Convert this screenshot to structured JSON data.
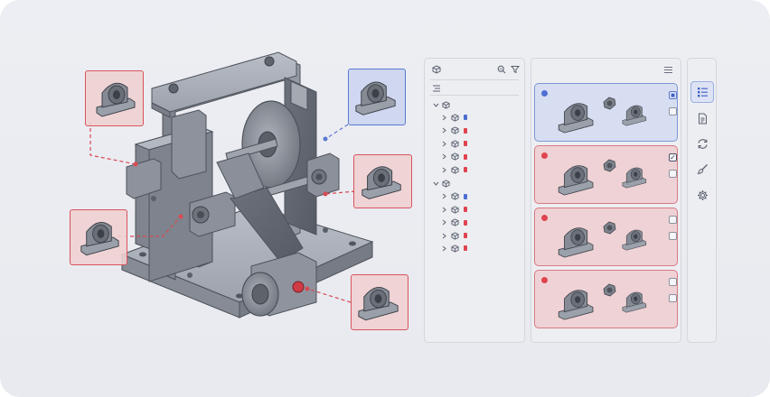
{
  "colors": {
    "accent_blue": "#4e6fd2",
    "accent_red": "#e0444f",
    "panel_bg": "#edeef2",
    "metal": "#8a8f99"
  },
  "viewport": {
    "callouts": [
      {
        "id": "callout-left-top",
        "status": "error",
        "icon": "pillow-block-bearing-icon"
      },
      {
        "id": "callout-left-bottom",
        "status": "error",
        "icon": "pillow-block-bearing-icon"
      },
      {
        "id": "callout-top-right",
        "status": "selected",
        "icon": "pillow-block-bearing-icon"
      },
      {
        "id": "callout-mid-right",
        "status": "error",
        "icon": "pillow-block-bearing-icon"
      },
      {
        "id": "callout-bottom-right",
        "status": "error",
        "icon": "pillow-block-bearing-icon"
      }
    ]
  },
  "tree_panel": {
    "header_icons": [
      "cube-icon",
      "zoom-icon",
      "filter-icon"
    ],
    "subheader_icon": "collapse-all-icon",
    "groups": [
      {
        "expanded": true,
        "items": [
          {
            "tag": "none"
          },
          {
            "tag": "blue"
          },
          {
            "tag": "red"
          },
          {
            "tag": "red"
          },
          {
            "tag": "red"
          },
          {
            "tag": "red"
          }
        ]
      },
      {
        "expanded": true,
        "items": [
          {
            "tag": "none"
          },
          {
            "tag": "blue"
          },
          {
            "tag": "red"
          },
          {
            "tag": "red"
          },
          {
            "tag": "red"
          },
          {
            "tag": "red"
          }
        ]
      }
    ]
  },
  "list_panel": {
    "header_icon": "menu-icon",
    "cards": [
      {
        "status": "blue",
        "checks": [
          "partial",
          "off"
        ]
      },
      {
        "status": "red",
        "checks": [
          "on",
          "off"
        ]
      },
      {
        "status": "red",
        "checks": [
          "off",
          "off"
        ]
      },
      {
        "status": "red",
        "checks": [
          "off",
          "off"
        ]
      }
    ]
  },
  "side_panel": {
    "buttons": [
      {
        "icon": "list-view-icon",
        "active": true
      },
      {
        "icon": "document-icon",
        "active": false
      },
      {
        "icon": "sync-icon",
        "active": false
      },
      {
        "icon": "brush-icon",
        "active": false
      },
      {
        "icon": "settings-icon",
        "active": false
      }
    ]
  }
}
